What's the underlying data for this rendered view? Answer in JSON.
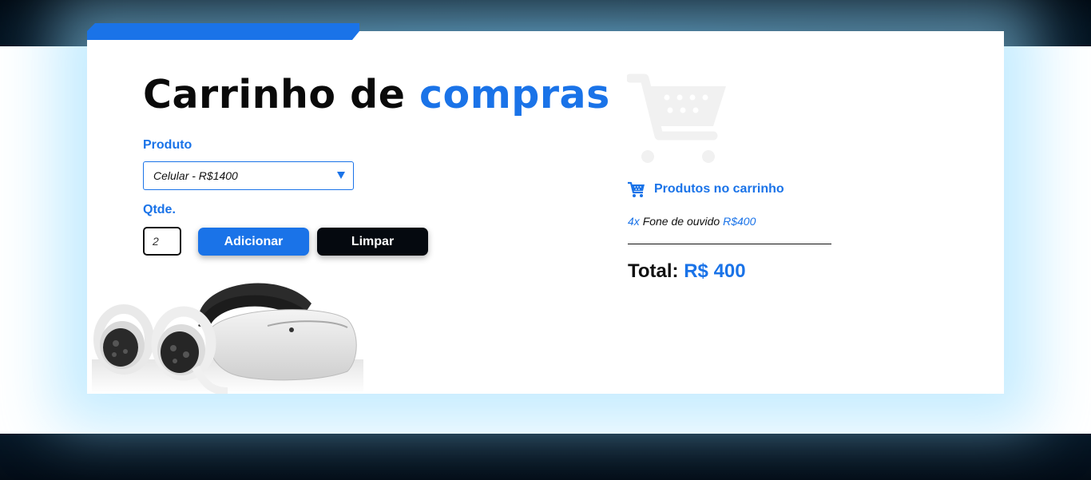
{
  "header": {
    "title_prefix": "Carrinho de",
    "title_accent": "compras"
  },
  "form": {
    "product_label": "Produto",
    "product_selected": "Celular - R$1400",
    "qty_label": "Qtde.",
    "qty_value": "2",
    "add_button": "Adicionar",
    "clear_button": "Limpar"
  },
  "cart": {
    "heading": "Produtos no carrinho",
    "items": [
      {
        "qty": "4x",
        "name": "Fone de ouvido",
        "price": "R$400"
      }
    ],
    "total_label": "Total:",
    "total_value": "R$ 400"
  },
  "colors": {
    "accent": "#1a73e8",
    "dark": "#05090f",
    "glow": "#96dcff"
  },
  "icons": [
    "cart-watermark-icon",
    "cart-icon",
    "dropdown-caret-icon"
  ]
}
